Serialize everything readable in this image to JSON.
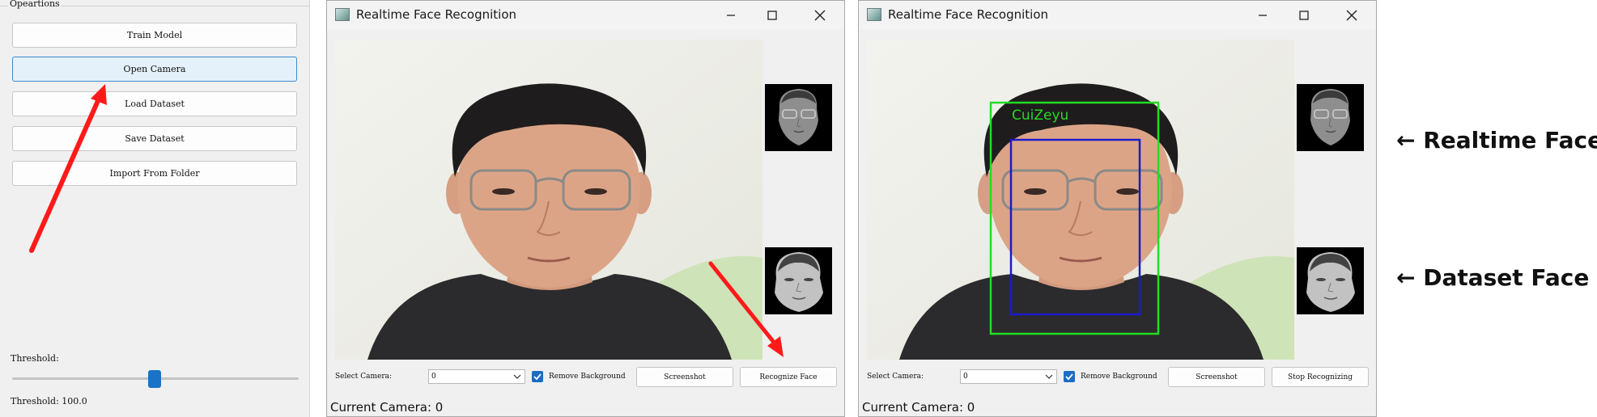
{
  "operations": {
    "group_title": "Opeartions",
    "buttons": [
      {
        "label": "Train Model"
      },
      {
        "label": "Open Camera"
      },
      {
        "label": "Load Dataset"
      },
      {
        "label": "Save Dataset"
      },
      {
        "label": "Import From Folder"
      }
    ],
    "threshold_label": "Threshold:",
    "threshold_value_text": "Threshold: 100.0",
    "threshold_slider_fraction": 0.48
  },
  "windows": [
    {
      "title": "Realtime Face Recognition",
      "select_camera_label": "Select Camera:",
      "camera_value": "0",
      "remove_background_label": "Remove Background",
      "remove_background_checked": true,
      "screenshot_label": "Screenshot",
      "action_label": "Recognize Face",
      "status": "Current Camera: 0"
    },
    {
      "title": "Realtime Face Recognition",
      "select_camera_label": "Select Camera:",
      "camera_value": "0",
      "remove_background_label": "Remove Background",
      "remove_background_checked": true,
      "screenshot_label": "Screenshot",
      "action_label": "Stop Recognizing",
      "status": "Current Camera: 0",
      "detected_name": "CuiZeyu"
    }
  ],
  "annotations": {
    "realtime_face": "←  Realtime Face",
    "dataset_face": "←  Dataset Face"
  },
  "colors": {
    "accent_blue": "#1a6dc4",
    "arrow_red": "#ff1a1a",
    "detection_green": "#22dd22",
    "face_box_blue": "#1a1acc"
  },
  "icons": [
    "app-icon",
    "minimize-icon",
    "maximize-icon",
    "close-icon",
    "dropdown-arrow-icon",
    "checkmark-icon",
    "left-arrow-icon"
  ]
}
